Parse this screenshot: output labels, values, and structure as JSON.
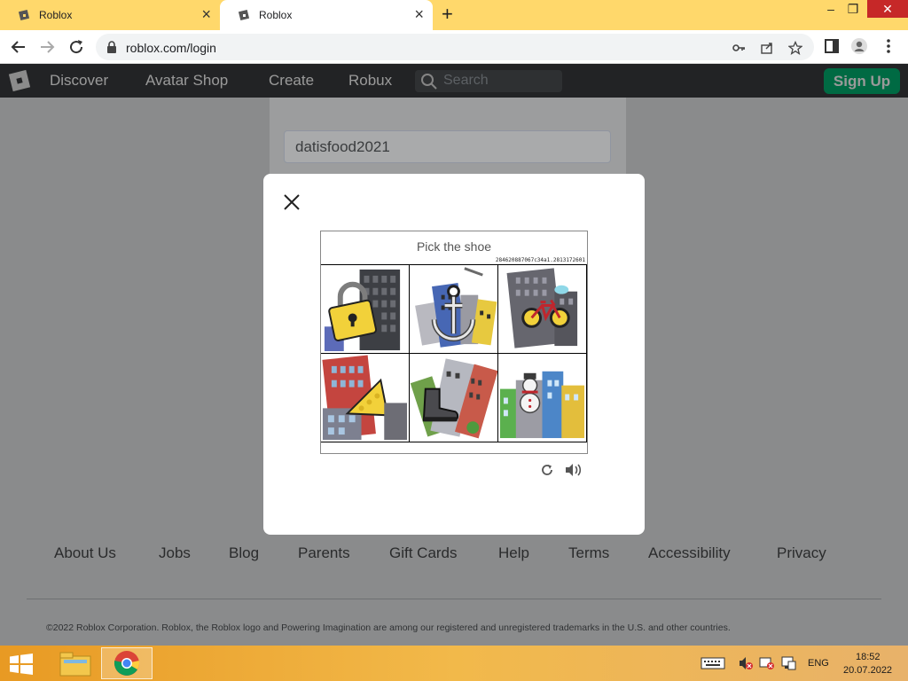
{
  "browser": {
    "tabs": [
      {
        "label": "Roblox",
        "active": false
      },
      {
        "label": "Roblox",
        "active": true
      }
    ],
    "address": "roblox.com/login"
  },
  "nav": {
    "links": [
      "Discover",
      "Avatar Shop",
      "Create",
      "Robux"
    ],
    "search_placeholder": "Search",
    "signup_label": "Sign Up"
  },
  "login": {
    "username_value": "datisfood2021"
  },
  "captcha": {
    "prompt": "Pick the shoe",
    "challenge_id": "284620887067c34a1.2813172601",
    "tiles": [
      "padlock",
      "anchor",
      "bicycle",
      "cheese",
      "shoe",
      "snowman"
    ]
  },
  "footer": {
    "links": [
      "About Us",
      "Jobs",
      "Blog",
      "Parents",
      "Gift Cards",
      "Help",
      "Terms",
      "Accessibility",
      "Privacy"
    ],
    "copyright": "©2022 Roblox Corporation. Roblox, the Roblox logo and Powering Imagination are among our registered and unregistered trademarks in the U.S. and other countries."
  },
  "taskbar": {
    "language": "ENG",
    "time": "18:52",
    "date": "20.07.2022"
  },
  "colors": {
    "tabbar": "#ffd86b",
    "signup": "#00b06f",
    "overlay": "#8a8b8c"
  }
}
